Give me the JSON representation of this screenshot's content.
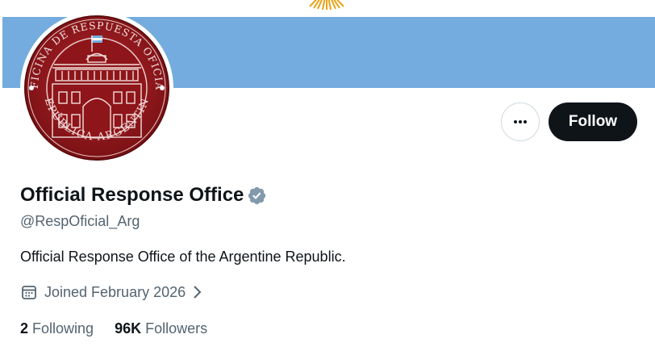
{
  "profile": {
    "display_name": "Official Response Office",
    "handle": "@RespOficial_Arg",
    "bio": "Official Response Office of the Argentine Republic.",
    "joined": "Joined February 2026",
    "verified": true
  },
  "avatar": {
    "seal_top_text": "OFICINA DE RESPUESTA OFICIAL",
    "seal_bottom_text": "REPÚBLICA ARGENTINA",
    "seal_color": "#9b1b1f"
  },
  "actions": {
    "follow_label": "Follow",
    "more_icon": "more-horizontal-icon"
  },
  "stats": {
    "following_count": "2",
    "following_label": "Following",
    "followers_count": "96K",
    "followers_label": "Followers"
  },
  "colors": {
    "banner": "#74acdf",
    "follow_button": "#0f1419",
    "secondary_text": "#536471",
    "verified_badge": "#829aab",
    "sun": "#f6b40e"
  },
  "icons": {
    "verified": "verified-badge-icon",
    "calendar": "calendar-icon",
    "chevron": "chevron-right-icon"
  }
}
